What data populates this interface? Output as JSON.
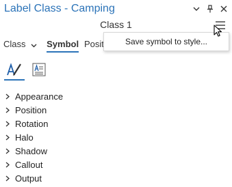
{
  "pane": {
    "title": "Label Class - Camping",
    "controls": {
      "options_icon": "chevron-down-icon",
      "pin_icon": "pin-icon",
      "close_icon": "close-icon"
    }
  },
  "class_name": "Class 1",
  "menu": {
    "icon": "hamburger-menu-icon",
    "items": [
      "Save symbol to style..."
    ]
  },
  "tabs": [
    {
      "label": "Class",
      "has_dropdown": true
    },
    {
      "label": "Symbol",
      "active": true
    },
    {
      "label": "Positi"
    }
  ],
  "subtools": [
    {
      "icon": "text-symbol-icon",
      "active": true
    },
    {
      "icon": "text-formatting-icon",
      "active": false
    }
  ],
  "sections": [
    {
      "label": "Appearance"
    },
    {
      "label": "Position"
    },
    {
      "label": "Rotation"
    },
    {
      "label": "Halo"
    },
    {
      "label": "Shadow"
    },
    {
      "label": "Callout"
    },
    {
      "label": "Output"
    }
  ],
  "colors": {
    "accent": "#2b73b8",
    "text": "#222222",
    "background": "#ffffff"
  }
}
